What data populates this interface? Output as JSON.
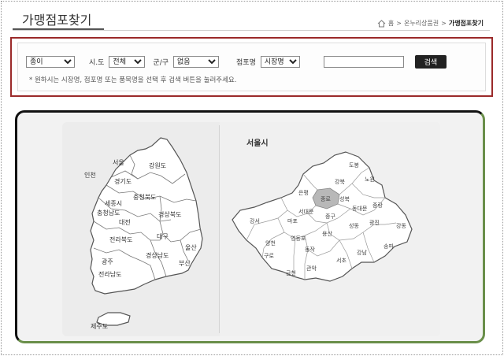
{
  "page": {
    "title": "가맹점포찾기"
  },
  "breadcrumb": {
    "home": "홈",
    "sep1": ">",
    "section": "온누리상품권",
    "sep2": ">",
    "current": "가맹점포찾기"
  },
  "search": {
    "type_value": "종이",
    "sido_label": "시.도",
    "sido_value": "전체",
    "gungu_label": "군/구",
    "gungu_value": "없음",
    "store_label": "점포명",
    "store_type_value": "시장명",
    "keyword_value": "",
    "button_label": "검색",
    "note": "* 원하시는 시장명, 점포명 또는 품목명을 선택 후 검색 버튼을 눌러주세요."
  },
  "korea_map": {
    "regions": [
      "인천",
      "서울",
      "강원도",
      "경기도",
      "충청북도",
      "세종시",
      "충청남도",
      "경상북도",
      "대전",
      "전라북도",
      "대구",
      "울산",
      "경상남도",
      "부산",
      "광주",
      "전라남도",
      "제주도"
    ]
  },
  "seoul_map": {
    "title": "서울시",
    "districts": [
      "도봉",
      "강북",
      "노원",
      "은평",
      "성북",
      "중랑",
      "종로",
      "동대문",
      "서대문",
      "강서",
      "마포",
      "중구",
      "성동",
      "광진",
      "강동",
      "용산",
      "영등포",
      "양천",
      "동작",
      "송파",
      "구로",
      "서초",
      "강남",
      "금천",
      "관악"
    ],
    "highlight_color": "#b8b8b8"
  },
  "colors": {
    "accent_border": "#9b2a2a",
    "panel_green": "#6a8f4a"
  }
}
